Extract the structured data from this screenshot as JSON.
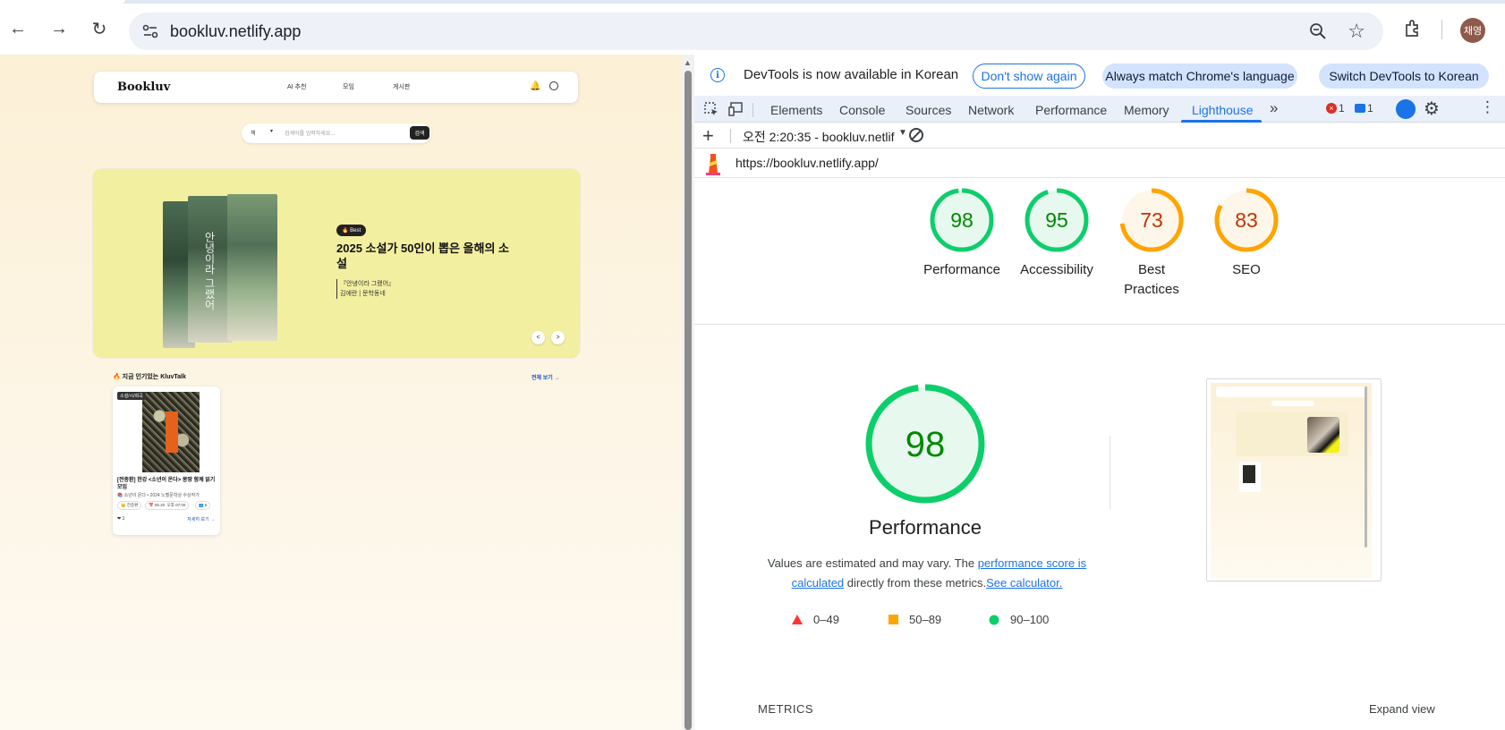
{
  "browser": {
    "url": "bookluv.netlify.app",
    "profile_initials": "채영"
  },
  "site": {
    "logo": "Bookluv",
    "nav": [
      "AI 추천",
      "모임",
      "게시판"
    ],
    "search": {
      "category": "책",
      "placeholder": "검색어를 입력하세요...",
      "button": "검색"
    },
    "hero": {
      "badge": "🔥 Best",
      "title": "2025 소설가 50인이 뽑은 올해의 소설",
      "sub1": "『안녕이라 그랬어』",
      "sub2": "김애란 | 문학동네",
      "book_spine_text": "안녕이라 그랬어",
      "prev": "<",
      "next": ">"
    },
    "popular": {
      "title": "🔥 지금 인기있는 KluvTalk",
      "more": "전체 보기 →",
      "card": {
        "tag": "소설/시/희곡",
        "title": "[전종환] 한강 <소년이 온다> 몽땅 함께 읽기 모임",
        "meta": "📚 소년이 온다 • 2024 노벨문학상 수상작가",
        "chips": [
          "👑 전종환",
          "📅 05.20. 오후 07:00",
          "👥 5"
        ],
        "likes": "❤ 1",
        "detail": "자세히 보기 →"
      }
    }
  },
  "devtools": {
    "infobar": {
      "text": "DevTools is now available in Korean",
      "btn_dont_show": "Don't show again",
      "btn_always_match": "Always match Chrome's language",
      "btn_switch": "Switch DevTools to Korean"
    },
    "tabs": [
      "Elements",
      "Console",
      "Sources",
      "Network",
      "Performance",
      "Memory",
      "Lighthouse"
    ],
    "active_tab": "Lighthouse",
    "errors": "1",
    "messages": "1",
    "report_label": "오전 2:20:35 - bookluv.netlif",
    "report_url": "https://bookluv.netlify.app/",
    "scores": [
      {
        "label": "Performance",
        "value": "98",
        "fraction": 0.98,
        "color": "#0cce6b",
        "bg": "#e7f9ef",
        "text_color": "#008800"
      },
      {
        "label": "Accessibility",
        "value": "95",
        "fraction": 0.95,
        "color": "#0cce6b",
        "bg": "#e7f9ef",
        "text_color": "#008800"
      },
      {
        "label": "Best Practices",
        "value": "73",
        "fraction": 0.73,
        "color": "#ffa400",
        "bg": "#fff6ea",
        "text_color": "#c33300"
      },
      {
        "label": "SEO",
        "value": "83",
        "fraction": 0.83,
        "color": "#ffa400",
        "bg": "#fff6ea",
        "text_color": "#c33300"
      }
    ],
    "performance": {
      "value": "98",
      "fraction": 0.98,
      "title": "Performance",
      "desc_prefix": "Values are estimated and may vary. The ",
      "desc_link1": "performance score is calculated",
      "desc_middle": " directly from these metrics.",
      "desc_link2": "See calculator.",
      "legend": [
        "0–49",
        "50–89",
        "90–100"
      ],
      "metrics_label": "METRICS",
      "expand_label": "Expand view"
    }
  }
}
